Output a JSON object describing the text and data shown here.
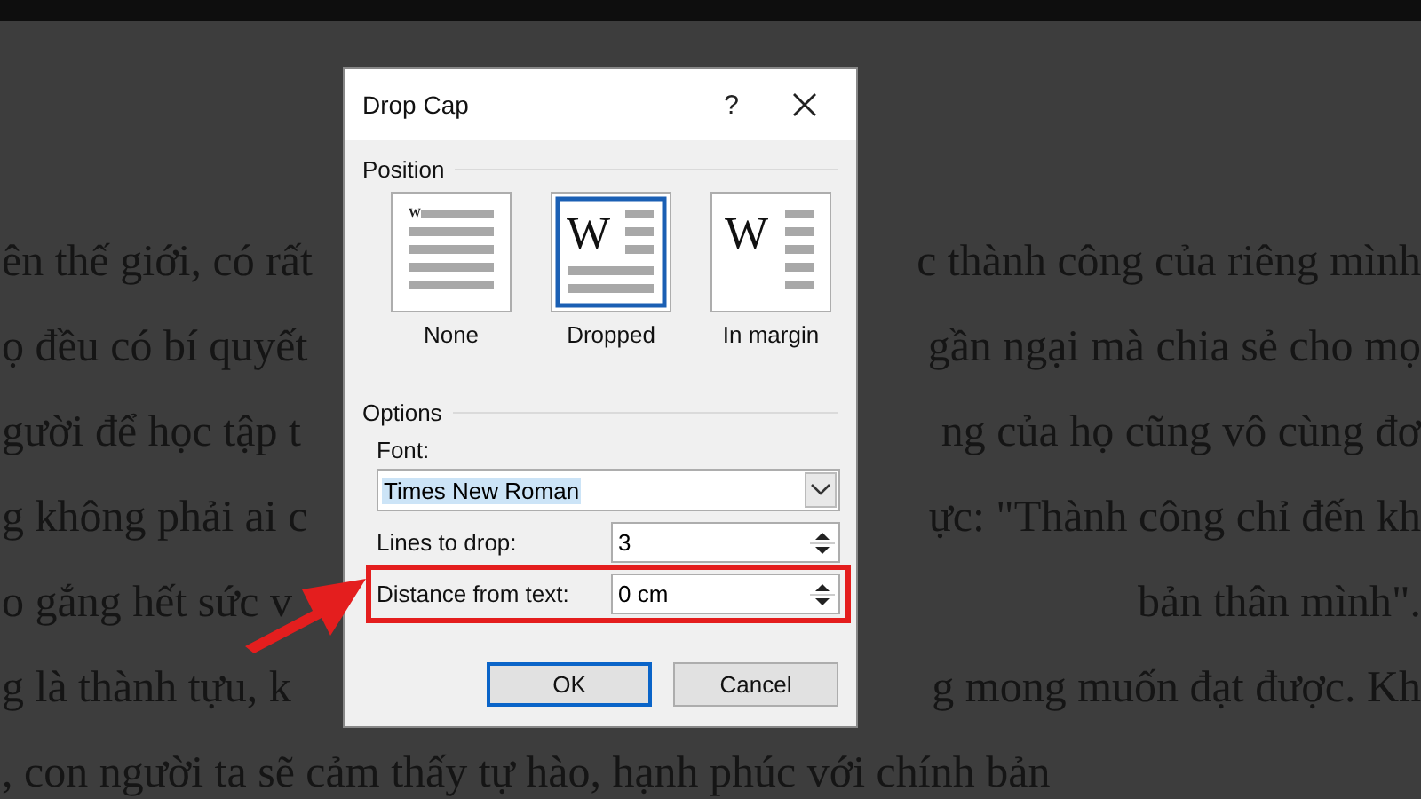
{
  "document": {
    "lines": [
      {
        "left": "ên thế giới, có rất",
        "right": "c thành công của riêng mình"
      },
      {
        "left": "ọ đều có bí quyết",
        "right": "gần ngại mà chia sẻ cho mọ"
      },
      {
        "left": "gười để học tập t",
        "right": "ng của họ cũng vô cùng đơ"
      },
      {
        "left": "g không phải ai c",
        "right": "ực: \"Thành công chỉ đến kh"
      },
      {
        "left": "o gắng hết sức v",
        "right": "bản thân mình\"."
      },
      {
        "left": "g là thành tựu, k",
        "right": "g mong muốn đạt được. Kh"
      },
      {
        "left": ", con người ta sẽ cảm thấy tự hào, hạnh phúc với chính bản"
      }
    ]
  },
  "dialog": {
    "title": "Drop Cap",
    "help": "?",
    "position": {
      "label": "Position",
      "options": [
        {
          "label": "None",
          "glyph": "W",
          "kind": "none",
          "selected": false
        },
        {
          "label": "Dropped",
          "glyph": "W",
          "kind": "dropped",
          "selected": true
        },
        {
          "label": "In margin",
          "glyph": "W",
          "kind": "margin",
          "selected": false
        }
      ]
    },
    "options": {
      "label": "Options",
      "fields": [
        {
          "kind": "combo",
          "label": "Font:",
          "value": "Times New Roman",
          "highlighted": false
        },
        {
          "kind": "spin",
          "label": "Lines to drop:",
          "value": "3",
          "highlighted": false
        },
        {
          "kind": "spin",
          "label": "Distance from text:",
          "value": "0 cm",
          "highlighted": true
        }
      ]
    },
    "buttons": [
      {
        "label": "OK",
        "default": true
      },
      {
        "label": "Cancel",
        "default": false
      }
    ]
  }
}
